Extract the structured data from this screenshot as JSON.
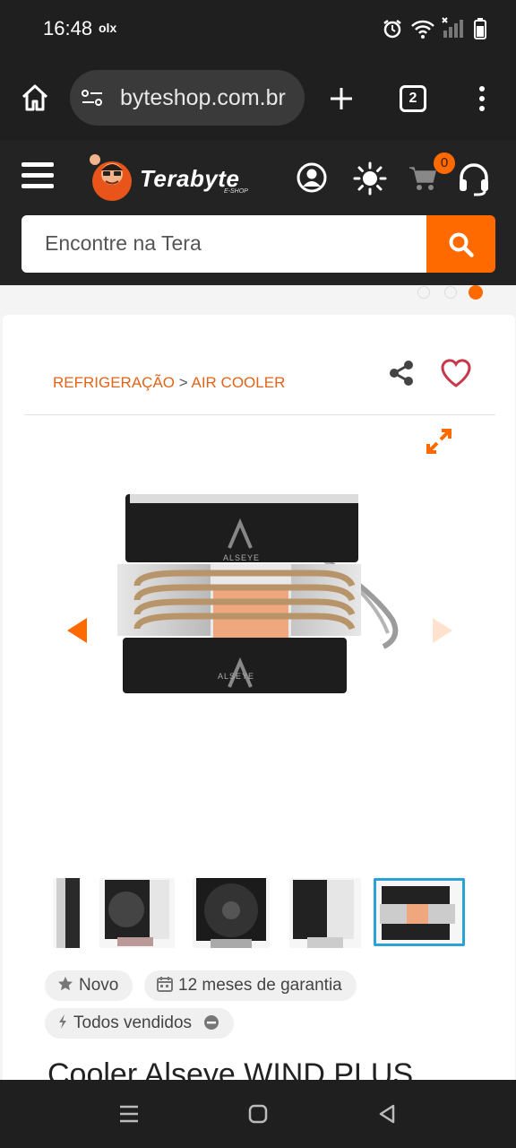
{
  "status_bar": {
    "time": "16:48",
    "notification_app": "olx"
  },
  "browser": {
    "url": "byteshop.com.br",
    "tab_count": "2"
  },
  "site": {
    "logo_name": "Terabyte",
    "logo_sub": "E-SHOP",
    "cart_count": "0",
    "search_placeholder": "Encontre na Tera"
  },
  "product": {
    "breadcrumb_category": "REFRIGERAÇÃO",
    "breadcrumb_separator": ">",
    "breadcrumb_subcategory": "AIR COOLER",
    "brand_on_image": "ALSEYE",
    "chips": {
      "condition": "Novo",
      "warranty": "12 meses de garantia",
      "stock": "Todos vendidos"
    },
    "title": "Cooler Alseye WIND PLUS"
  },
  "colors": {
    "accent": "#ff6a00",
    "header_bg": "#232323",
    "breadcrumb": "#e0641a"
  },
  "icons": [
    "home-icon",
    "site-settings-icon",
    "new-tab-icon",
    "tabs-icon",
    "more-icon",
    "menu-icon",
    "user-icon",
    "theme-icon",
    "cart-icon",
    "support-icon",
    "search-icon",
    "share-icon",
    "favorite-icon",
    "expand-icon",
    "arrow-left-icon",
    "arrow-right-icon",
    "star-icon",
    "calendar-icon",
    "bolt-icon",
    "minus-circle-icon"
  ]
}
